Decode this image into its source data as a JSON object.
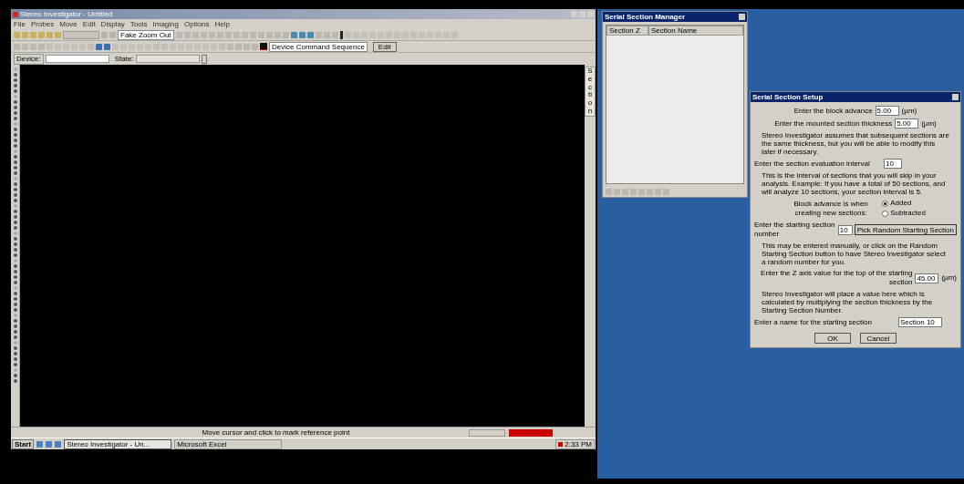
{
  "main_window": {
    "title": "Stereo Investigator - Untitled",
    "menu": [
      "File",
      "Probes",
      "Move",
      "Edit",
      "Display",
      "Tools",
      "Imaging",
      "Options",
      "Help"
    ],
    "zoom_dropdown": "Fake Zoom Out",
    "command_sequence": "Device Command Sequence",
    "edit_button": "Edit",
    "device_label": "Device:",
    "state_label": "State:",
    "side_tab": "Section",
    "status_text": "Move cursor and click to mark reference point"
  },
  "taskbar": {
    "start": "Start",
    "tasks": [
      {
        "label": "Stereo Investigator - Un...",
        "selected": true
      },
      {
        "label": "Microsoft Excel",
        "selected": false
      }
    ],
    "clock": "2:33 PM"
  },
  "section_manager": {
    "title": "Serial Section Manager",
    "columns": [
      "Section Z",
      "Section Name"
    ]
  },
  "setup_dialog": {
    "title": "Serial Section Setup",
    "rows": [
      {
        "kind": "field",
        "label": "Enter the block advance",
        "value": "5.00",
        "unit": "(µm)"
      },
      {
        "kind": "field",
        "label": "Enter the mounted section thickness",
        "value": "5.00",
        "unit": "(µm)"
      },
      {
        "kind": "note",
        "text": "Stereo Investigator assumes that subsequent sections are the same thickness, but you will be able to modify this later if necessary."
      },
      {
        "kind": "field",
        "label": "Enter the section evaluation interval",
        "value": "10"
      },
      {
        "kind": "note",
        "text": "This is the interval of sections that you will skip in your analysis. Example: If you have a total of 50 sections, and will analyze 10 sections, your section interval is 5."
      },
      {
        "kind": "radio",
        "label": "Block advance is when creating new sections:",
        "options": [
          {
            "label": "Added",
            "selected": true
          },
          {
            "label": "Subtracted",
            "selected": false
          }
        ]
      },
      {
        "kind": "field_button",
        "label": "Enter the starting section number",
        "value": "10",
        "button": "Pick Random Starting Section"
      },
      {
        "kind": "note",
        "text": "This may be entered manually, or click on the Random Starting Section button to have Stereo Investigator select a random number for you."
      },
      {
        "kind": "field",
        "label": "Enter the Z axis value for the top of the starting section",
        "value": "45.00",
        "unit": "(µm)"
      },
      {
        "kind": "note",
        "text": "Stereo Investigator will place a value here which is calculated by multiplying the section thickness by the Starting Section Number."
      },
      {
        "kind": "field",
        "label": "Enter a name for the starting section",
        "value": "Section 10"
      }
    ],
    "buttons": [
      "OK",
      "Cancel"
    ]
  }
}
